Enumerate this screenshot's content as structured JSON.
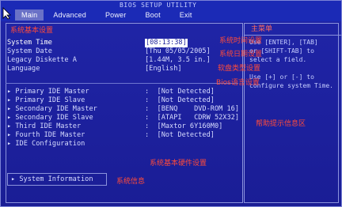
{
  "bios": {
    "title": "BIOS SETUP UTILITY"
  },
  "menu": [
    "Main",
    "Advanced",
    "Power",
    "Boot",
    "Exit"
  ],
  "right_panel": {
    "title": "主菜单",
    "text": "Use [ENTER], [TAB]\nor [SHIFT-TAB] to\nselect a field.\n\nUse [+] or [-] to\nconfigure system Time."
  },
  "settings": [
    {
      "label": "System Time",
      "value": "[08:13:38]"
    },
    {
      "label": "System Date",
      "value": "[Thu 05/05/2005]"
    },
    {
      "label": "Legacy Diskette A",
      "value": "[1.44M, 3.5 in.]"
    },
    {
      "label": "Language",
      "value": "[English]"
    }
  ],
  "devices": [
    {
      "label": "Primary IDE Master",
      "value": ":  [Not Detected]"
    },
    {
      "label": "Primary IDE Slave",
      "value": ":  [Not Detected]"
    },
    {
      "label": "Secondary IDE Master",
      "value": ":  [BENQ    DVD-ROM 16]"
    },
    {
      "label": "Secondary IDE Slave",
      "value": ":  [ATAPI   CDRW 52X32]"
    },
    {
      "label": "Third IDE Master",
      "value": ":  [Maxtor 6Y160M0]"
    },
    {
      "label": "Fourth IDE Master",
      "value": ":  [Not Detected]"
    },
    {
      "label": "IDE Configuration",
      "value": ""
    }
  ],
  "system_information": "System Information",
  "notes": {
    "basic": "系统基本设置",
    "time": "系统时间设置",
    "date": "系统日期设置",
    "floppy": "软盘类型设置",
    "language": "Bios语言设置",
    "help": "帮助提示信息区",
    "hardware": "系统基本硬件设置",
    "sysinfo": "系统信息"
  }
}
